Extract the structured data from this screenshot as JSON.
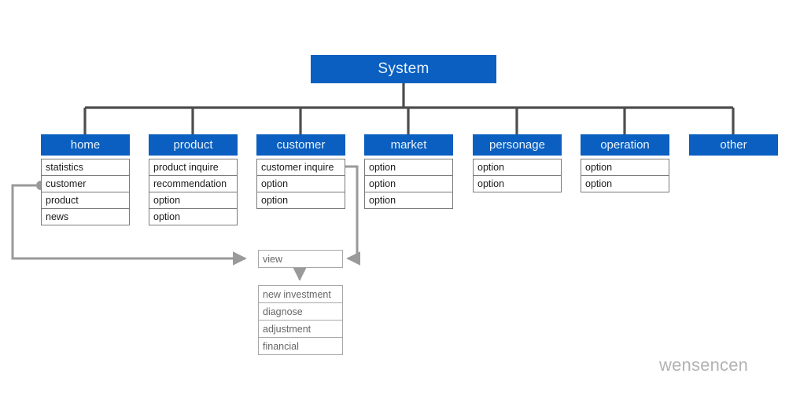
{
  "diagram": {
    "root": {
      "label": "System"
    },
    "columns": [
      {
        "key": "home",
        "header": "home",
        "items": [
          "statistics",
          "customer",
          "product",
          "news"
        ]
      },
      {
        "key": "product",
        "header": "product",
        "items": [
          "product inquire",
          "recommendation",
          "option",
          "option"
        ]
      },
      {
        "key": "customer",
        "header": "customer",
        "items": [
          "customer inquire",
          "option",
          "option"
        ]
      },
      {
        "key": "market",
        "header": "market",
        "items": [
          "option",
          "option",
          "option"
        ]
      },
      {
        "key": "personage",
        "header": "personage",
        "items": [
          "option",
          "option"
        ]
      },
      {
        "key": "operation",
        "header": "operation",
        "items": [
          "option",
          "option"
        ]
      },
      {
        "key": "other",
        "header": "other",
        "items": []
      }
    ],
    "view_node": {
      "label": "view"
    },
    "detail_node": {
      "items": [
        "new investment",
        "diagnose",
        "adjustment",
        "financial"
      ]
    },
    "watermark": "wensencen",
    "colors": {
      "node_blue": "#0a5fc0",
      "node_text": "#eaf3fc",
      "tree_line": "#4d4d4d",
      "flow_line": "#9a9a9a",
      "box_border": "#7a7a7a",
      "grey_border": "#a8a8a8",
      "grey_text": "#666666",
      "watermark": "#b3b3b3"
    }
  }
}
